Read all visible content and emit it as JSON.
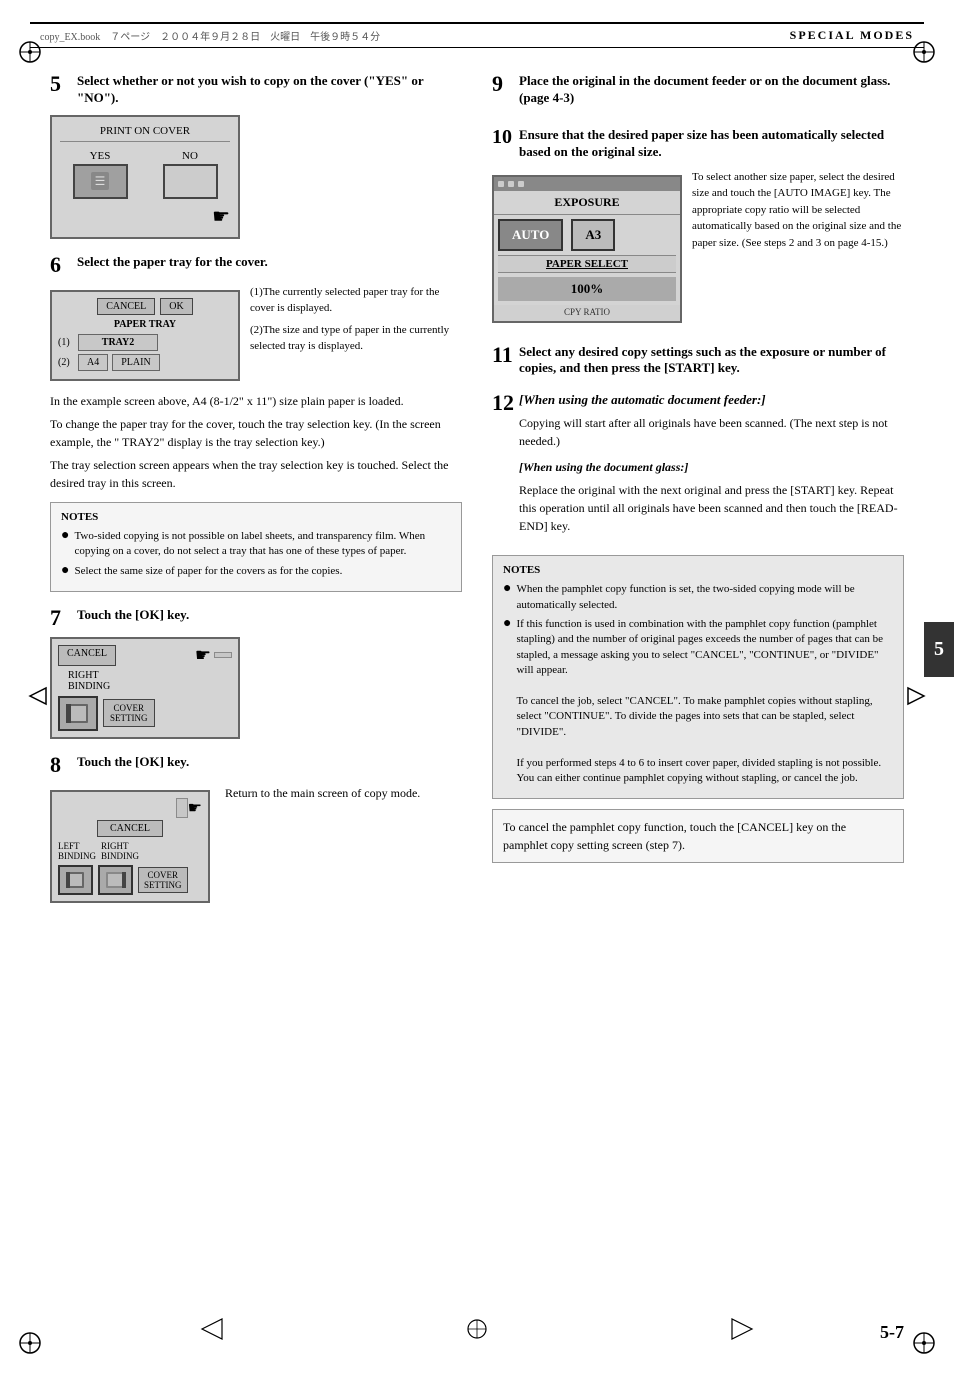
{
  "header": {
    "left_text": "copy_EX.book　７ページ　２００４年９月２８日　火曜日　午後９時５４分",
    "right_text": "SPECIAL MODES"
  },
  "steps": {
    "step5": {
      "number": "5",
      "text": "Select whether or not you wish to copy on the cover (\"YES\" or \"NO\").",
      "screen_title": "PRINT ON COVER",
      "btn_yes": "YES",
      "btn_no": "NO"
    },
    "step6": {
      "number": "6",
      "text": "Select the paper tray for the cover.",
      "btn_cancel": "CANCEL",
      "btn_ok": "OK",
      "label": "PAPER TRAY",
      "row1_num": "(1)",
      "row1_tray": "TRAY2",
      "row2_num": "(2)",
      "row2_tray": "PLAIN",
      "row2_size": "A4",
      "desc1": "(1)The currently selected paper tray for the cover is displayed.",
      "desc2": "(2)The size and type of paper in the currently selected tray is displayed.",
      "body1": "In the example screen above, A4 (8-1/2\" x 11\") size plain paper is loaded.",
      "body2": "To change the paper tray for the cover, touch the tray selection key. (In the screen example, the \" TRAY2\" display is the tray selection key.)",
      "body3": "The tray selection screen appears when the tray selection key is touched. Select the desired tray in this screen."
    },
    "step7": {
      "number": "7",
      "text": "Touch the [OK] key.",
      "btn_cancel": "CANCEL",
      "label_right": "RIGHT",
      "label_binding": "BINDING",
      "label_cover": "COVER",
      "label_setting": "SETTING"
    },
    "step8": {
      "number": "8",
      "text": "Touch the [OK] key.",
      "btn_cancel": "CANCEL",
      "label_left": "LEFT",
      "label_right": "RIGHT",
      "label_binding": "BINDING",
      "label_binding2": "BINDING",
      "label_cover": "COVER",
      "label_setting": "SETTING",
      "return_text": "Return to the main screen of copy mode."
    },
    "step9": {
      "number": "9",
      "text": "Place the original in the document feeder or on the document glass. (page 4-3)"
    },
    "step10": {
      "number": "10",
      "text": "Ensure that the desired paper size has been automatically selected based on the original size.",
      "screen": {
        "exposure": "EXPOSURE",
        "auto": "AUTO",
        "a3": "A3",
        "paper_select": "PAPER SELECT",
        "percent": "100%",
        "copy_ratio": "CPY RATIO"
      },
      "desc": "To select another size paper, select the desired size and touch the [AUTO IMAGE] key. The appropriate copy ratio will be selected automatically based on the original size and the paper size. (See steps 2 and 3 on page 4-15.)"
    },
    "step11": {
      "number": "11",
      "text": "Select any desired copy settings such as the exposure or number of copies, and then press the [START] key."
    },
    "step12": {
      "number": "12",
      "text": "[When using the automatic document feeder:]",
      "body": "Copying will start after all originals have been scanned. (The next step is not needed.)",
      "glass_title": "[When using the document glass:]",
      "glass_body": "Replace the original with the next original and press the [START] key. Repeat this operation until all originals have been scanned and then touch the [READ-END] key."
    }
  },
  "notes_left": {
    "title": "NOTES",
    "items": [
      "Two-sided copying is not possible on label sheets, and transparency film. When copying on a cover, do not select a tray that has one of these types of paper.",
      "Select the same size of paper for the covers as for the copies."
    ]
  },
  "notes_right": {
    "title": "NOTES",
    "items": [
      "When the pamphlet copy function is set, the two-sided copying mode will be automatically selected.",
      "If this function is used in combination with the pamphlet copy function (pamphlet stapling) and the number of original pages exceeds the number of pages that can be stapled, a message asking you to select \"CANCEL\", \"CONTINUE\", or \"DIVIDE\" will appear.\nTo cancel the job, select \"CANCEL\". To make pamphlet copies without stapling, select \"CONTINUE\". To divide the pages into sets that can be stapled, select \"DIVIDE\".\nIf you performed steps 4 to 6 to insert cover paper, divided stapling is not possible. You can either continue pamphlet copying without stapling, or cancel the job."
    ]
  },
  "cancel_box": {
    "text": "To cancel the pamphlet copy function, touch the [CANCEL] key on the pamphlet copy setting screen (step 7)."
  },
  "page_number": "5-7",
  "tab_number": "5"
}
